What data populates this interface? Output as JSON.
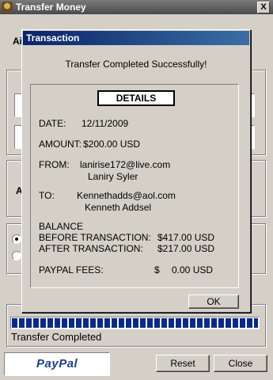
{
  "background_window": {
    "title": "Transfer Money",
    "close_symbol": "X",
    "partial_label_1": "Ai",
    "partial_label_2": "A",
    "status": "Transfer Completed",
    "progress": 1.0,
    "paypal_logo_text": "PayPal",
    "reset_label": "Reset",
    "close_label": "Close"
  },
  "dialog": {
    "title": "Transaction",
    "message": "Transfer Completed Successfully!",
    "details_label": "DETAILS",
    "date_label": "DATE:",
    "date_value": "12/11/2009",
    "amount_label": "AMOUNT:",
    "amount_value": "$200.00 USD",
    "from_label": "FROM:",
    "from_email": "lanirise172@live.com",
    "from_name": "Laniry Syler",
    "to_label": "TO:",
    "to_email": "Kennethadds@aol.com",
    "to_name": "Kenneth Addsel",
    "balance_label": "BALANCE",
    "before_label": "BEFORE TRANSACTION:",
    "before_value": "$417.00 USD",
    "after_label": "AFTER TRANSACTION:",
    "after_value": "$217.00 USD",
    "fees_label": "PAYPAL FEES:",
    "fees_currency": "$",
    "fees_value": "0.00 USD",
    "ok_label": "OK"
  },
  "colors": {
    "titlebar_active": "#0a246a",
    "window_face": "#d4d0c8",
    "progress": "#0a2a8a"
  }
}
